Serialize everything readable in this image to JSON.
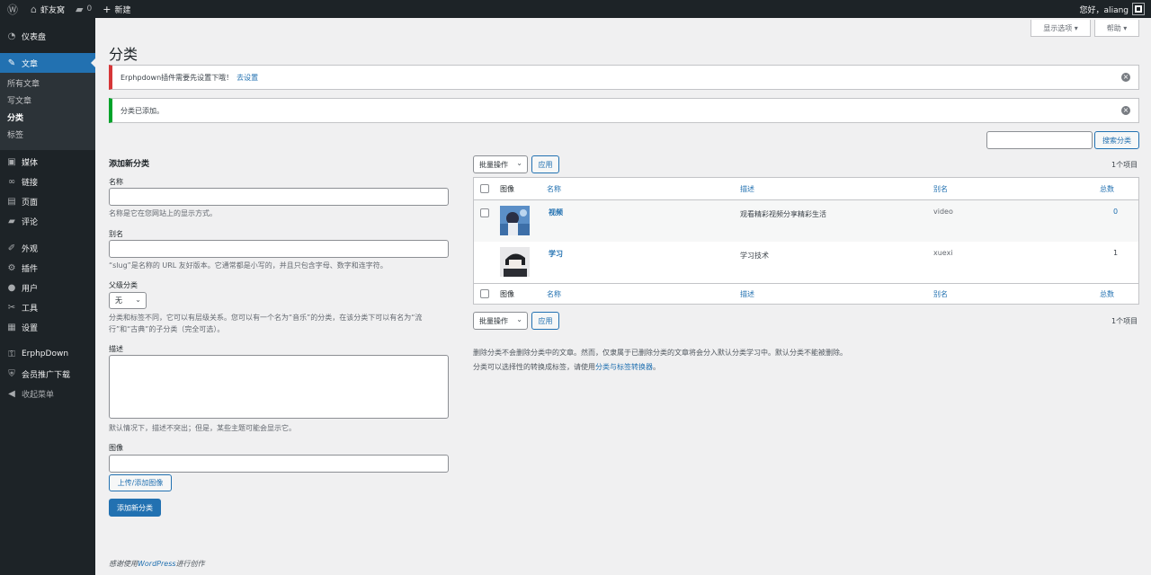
{
  "admin_bar": {
    "site_name": "虾友窝",
    "comments_count": "0",
    "new_label": "新建",
    "greeting": "您好，aliang"
  },
  "sidebar": {
    "items": [
      {
        "icon": "dashboard-icon",
        "glyph": "◔",
        "label": "仪表盘"
      },
      {
        "icon": "pin-icon",
        "glyph": "✎",
        "label": "文章"
      },
      {
        "icon": "media-icon",
        "glyph": "▣",
        "label": "媒体"
      },
      {
        "icon": "link-icon",
        "glyph": "∞",
        "label": "链接"
      },
      {
        "icon": "page-icon",
        "glyph": "▤",
        "label": "页面"
      },
      {
        "icon": "comment-icon",
        "glyph": "▰",
        "label": "评论"
      },
      {
        "icon": "appearance-icon",
        "glyph": "✐",
        "label": "外观"
      },
      {
        "icon": "plugin-icon",
        "glyph": "⚙",
        "label": "插件"
      },
      {
        "icon": "user-icon",
        "glyph": "●",
        "label": "用户"
      },
      {
        "icon": "tools-icon",
        "glyph": "✂",
        "label": "工具"
      },
      {
        "icon": "settings-icon",
        "glyph": "▦",
        "label": "设置"
      },
      {
        "icon": "key-icon",
        "glyph": "⚿",
        "label": "ErphpDown"
      },
      {
        "icon": "shield-icon",
        "glyph": "⛨",
        "label": "会员推广下载"
      },
      {
        "icon": "collapse-icon",
        "glyph": "◀",
        "label": "收起菜单"
      }
    ],
    "submenu": [
      "所有文章",
      "写文章",
      "分类",
      "标签"
    ]
  },
  "screen_options": "显示选项 ▾",
  "help": "帮助 ▾",
  "page_title": "分类",
  "notice_warning": {
    "text": "Erphpdown插件需要先设置下哦！",
    "link": "去设置"
  },
  "notice_success": {
    "text": "分类已添加。"
  },
  "search_button": "搜索分类",
  "form": {
    "heading": "添加新分类",
    "name_label": "名称",
    "name_desc": "名称是它在您网站上的显示方式。",
    "slug_label": "别名",
    "slug_desc": "“slug”是名称的 URL 友好版本。它通常都是小写的，并且只包含字母、数字和连字符。",
    "parent_label": "父级分类",
    "parent_value": "无",
    "parent_desc_1": "分类和标签不同，它可以有层级关系。您可以有一个名为“音乐”的分类，在该分类下可以有名为“流",
    "parent_desc_2": "行”和“古典”的子分类（完全可选）。",
    "desc_label": "描述",
    "desc_desc": "默认情况下，描述不突出；但是，某些主题可能会显示它。",
    "image_label": "图像",
    "upload_button": "上传/添加图像",
    "submit_button": "添加新分类"
  },
  "table": {
    "bulk_label": "批量操作",
    "apply_label": "应用",
    "item_count": "1个项目",
    "columns": {
      "image": "图像",
      "name": "名称",
      "description": "描述",
      "slug": "别名",
      "count": "总数"
    },
    "rows": [
      {
        "name": "视频",
        "description": "观看精彩视频分享精彩生活",
        "slug": "video",
        "count": "0"
      },
      {
        "name": "学习",
        "description": "学习技术",
        "slug": "xuexi",
        "count": "1"
      }
    ]
  },
  "help_text_1": "删除分类不会删除分类中的文章。然而，仅隶属于已删除分类的文章将会分入默认分类学习中。默认分类不能被删除。",
  "help_text_2_prefix": "分类可以选择性的转换成标签，请使用",
  "help_text_2_link": "分类与标签转换器",
  "help_text_2_suffix": "。",
  "footer_prefix": "感谢使用",
  "footer_link": "WordPress",
  "footer_suffix": "进行创作"
}
